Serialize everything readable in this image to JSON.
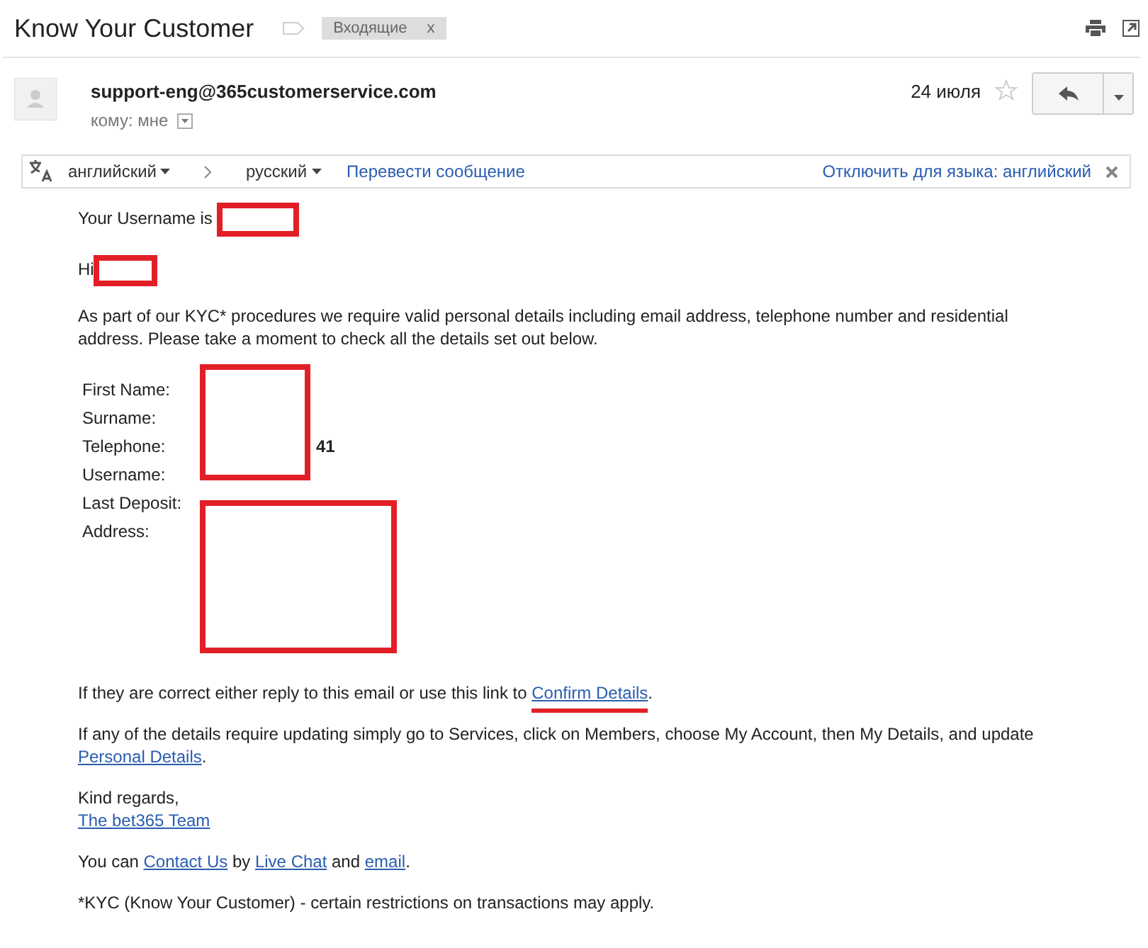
{
  "subject": "Know Your Customer",
  "label": {
    "text": "Входящие",
    "close": "x"
  },
  "sender": {
    "email": "support-eng@365customerservice.com",
    "to": "кому: мне",
    "date": "24 июля",
    "starred": false
  },
  "translate": {
    "from": "английский",
    "to": "русский",
    "action": "Перевести сообщение",
    "disable": "Отключить для языка: английский"
  },
  "username_line": "Your Username is",
  "greeting": "Hi",
  "intro": "As part of our KYC* procedures we require valid personal details including email address, telephone number and residential address. Please take a moment to check all the details set out below.",
  "details": [
    {
      "label": "First Name:"
    },
    {
      "label": "Surname:"
    },
    {
      "label": "Telephone:",
      "value": "41"
    },
    {
      "label": "Username:"
    },
    {
      "label": "Last Deposit:"
    },
    {
      "label": "Address:"
    }
  ],
  "paragraphs": [
    [
      {
        "kind": "text",
        "text": "If they are correct either reply to this email or use this link to "
      },
      {
        "kind": "link",
        "text": "Confirm Details",
        "marked": true
      },
      {
        "kind": "text",
        "text": "."
      }
    ],
    [
      {
        "kind": "text",
        "text": "If any of the details require updating simply go to Services, click on Members, choose My Account, then My Details, and update "
      },
      {
        "kind": "link",
        "text": "Personal Details",
        "marked": false
      },
      {
        "kind": "text",
        "text": "."
      }
    ],
    [
      {
        "kind": "text",
        "text": "Kind regards,"
      },
      {
        "kind": "break"
      },
      {
        "kind": "link",
        "text": "The bet365 Team",
        "marked": false
      }
    ],
    [
      {
        "kind": "text",
        "text": "You can "
      },
      {
        "kind": "link",
        "text": "Contact Us",
        "marked": false
      },
      {
        "kind": "text",
        "text": " by "
      },
      {
        "kind": "link",
        "text": "Live Chat",
        "marked": false
      },
      {
        "kind": "text",
        "text": " and "
      },
      {
        "kind": "link",
        "text": "email",
        "marked": false
      },
      {
        "kind": "text",
        "text": "."
      }
    ],
    [
      {
        "kind": "text",
        "text": "*KYC (Know Your Customer) - certain restrictions on transactions may apply."
      }
    ]
  ]
}
